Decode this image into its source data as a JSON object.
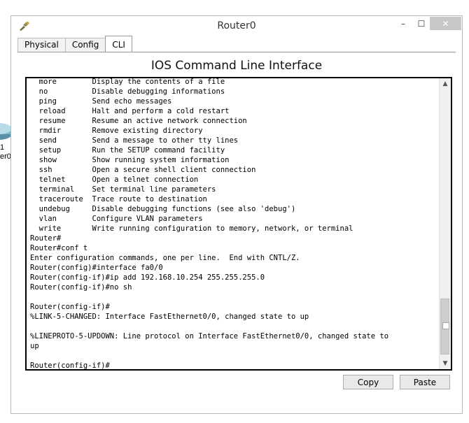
{
  "window": {
    "title": "Router0",
    "controls": {
      "minimize": "–",
      "maximize": "☐",
      "close": "✕"
    }
  },
  "background": {
    "device_label_1": "1",
    "device_label_2": "er0"
  },
  "tabs": [
    {
      "label": "Physical",
      "active": false
    },
    {
      "label": "Config",
      "active": false
    },
    {
      "label": "CLI",
      "active": true
    }
  ],
  "cli": {
    "heading": "IOS Command Line Interface",
    "lines": [
      "  more        Display the contents of a file",
      "  no          Disable debugging informations",
      "  ping        Send echo messages",
      "  reload      Halt and perform a cold restart",
      "  resume      Resume an active network connection",
      "  rmdir       Remove existing directory",
      "  send        Send a message to other tty lines",
      "  setup       Run the SETUP command facility",
      "  show        Show running system information",
      "  ssh         Open a secure shell client connection",
      "  telnet      Open a telnet connection",
      "  terminal    Set terminal line parameters",
      "  traceroute  Trace route to destination",
      "  undebug     Disable debugging functions (see also 'debug')",
      "  vlan        Configure VLAN parameters",
      "  write       Write running configuration to memory, network, or terminal",
      "Router#",
      "Router#conf t",
      "Enter configuration commands, one per line.  End with CNTL/Z.",
      "Router(config)#interface fa0/0",
      "Router(config-if)#ip add 192.168.10.254 255.255.255.0",
      "Router(config-if)#no sh",
      "",
      "Router(config-if)#",
      "%LINK-5-CHANGED: Interface FastEthernet0/0, changed state to up",
      "",
      "%LINEPROTO-5-UPDOWN: Line protocol on Interface FastEthernet0/0, changed state to",
      "up",
      "",
      "Router(config-if)#"
    ]
  },
  "buttons": {
    "copy": "Copy",
    "paste": "Paste"
  }
}
